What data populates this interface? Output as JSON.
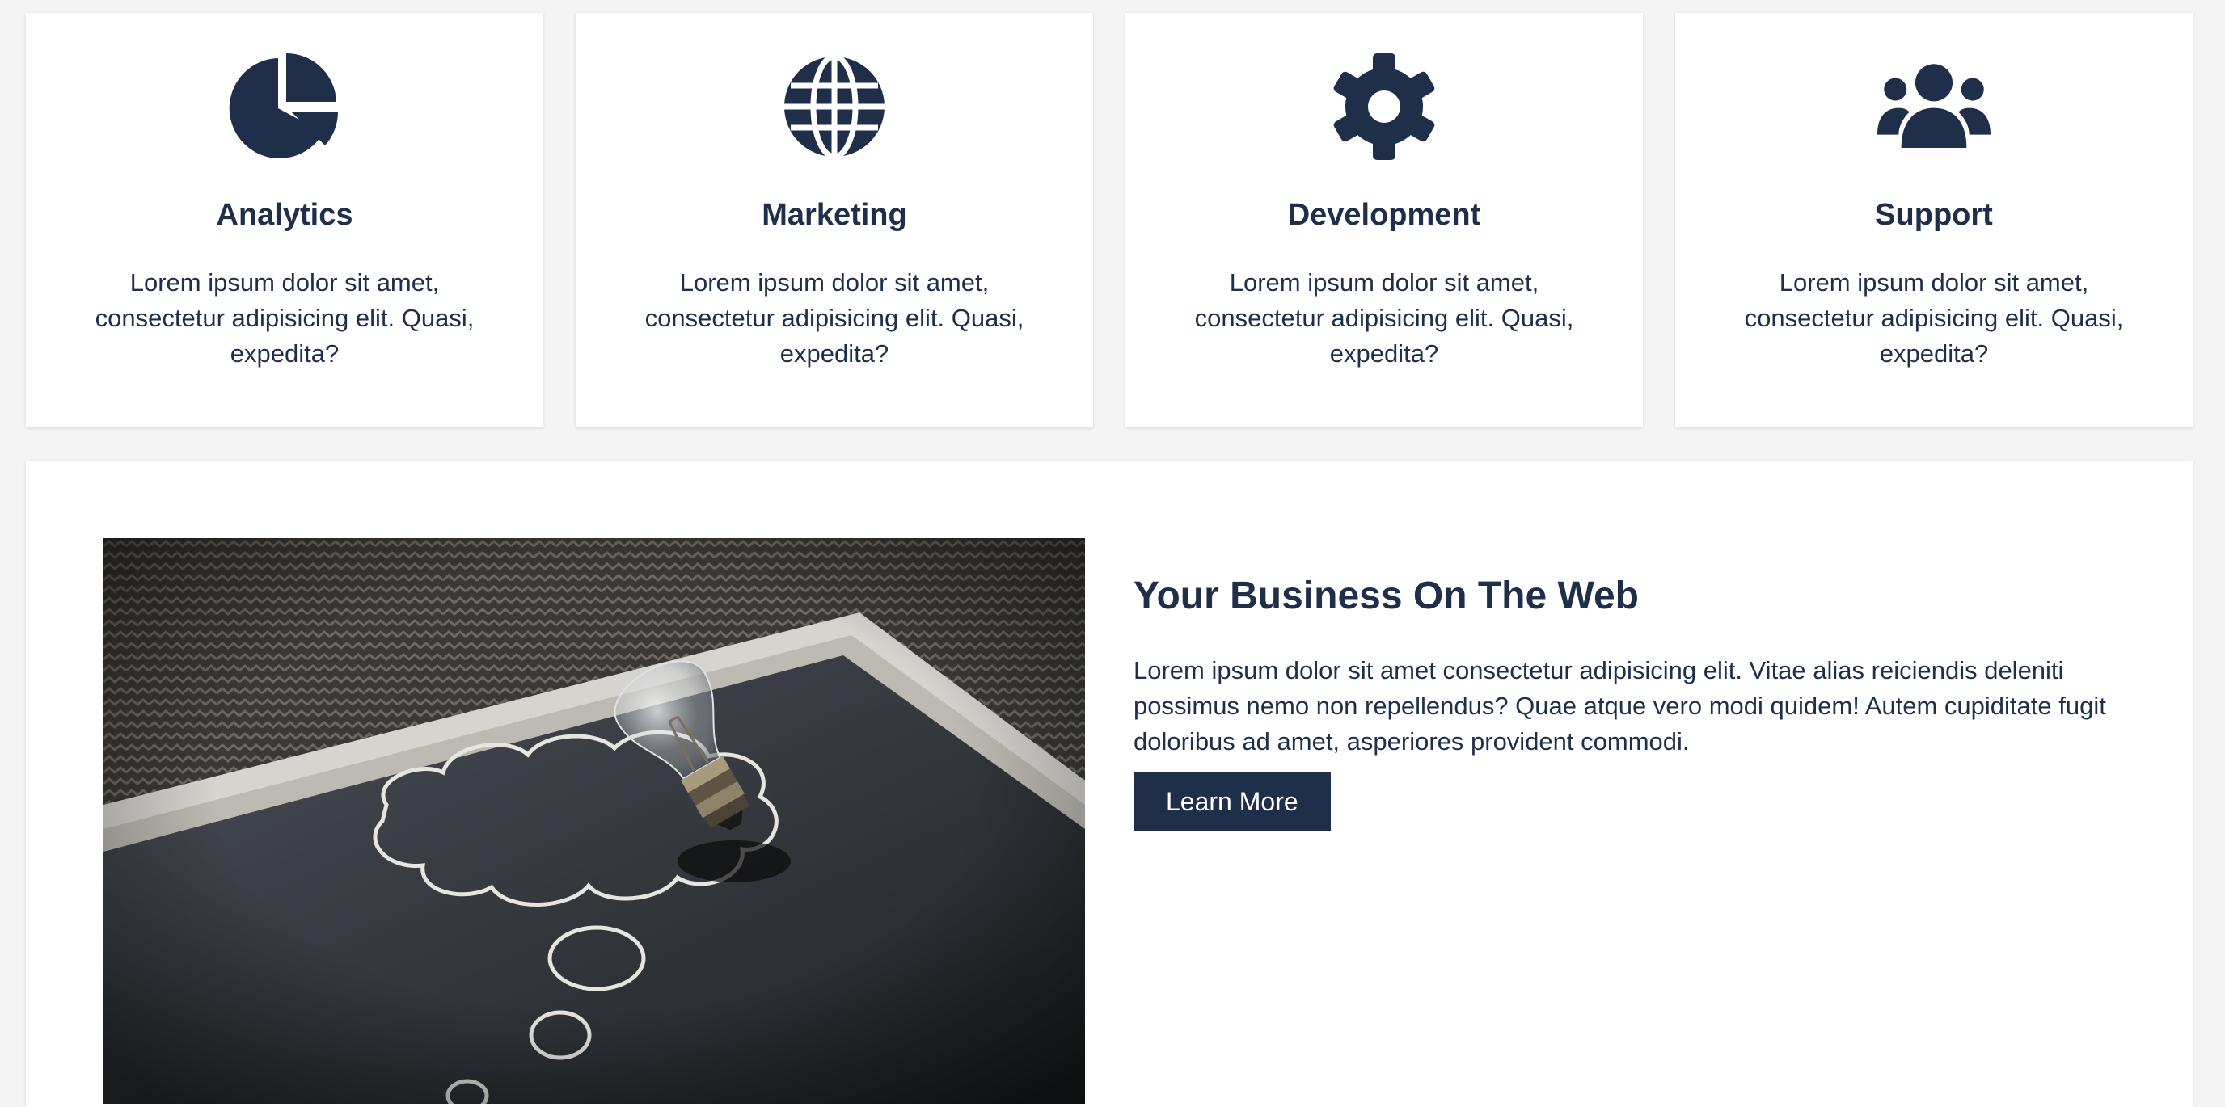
{
  "features": [
    {
      "icon": "pie-chart-icon",
      "title": "Analytics",
      "text": "Lorem ipsum dolor sit amet, consectetur adipisicing elit. Quasi, expedita?"
    },
    {
      "icon": "globe-icon",
      "title": "Marketing",
      "text": "Lorem ipsum dolor sit amet, consectetur adipisicing elit. Quasi, expedita?"
    },
    {
      "icon": "gear-icon",
      "title": "Development",
      "text": "Lorem ipsum dolor sit amet, consectetur adipisicing elit. Quasi, expedita?"
    },
    {
      "icon": "users-icon",
      "title": "Support",
      "text": "Lorem ipsum dolor sit amet, consectetur adipisicing elit. Quasi, expedita?"
    }
  ],
  "showcase": {
    "image": "lightbulb-on-chalkboard-photo",
    "title": "Your Business On The Web",
    "text": "Lorem ipsum dolor sit amet consectetur adipisicing elit. Vitae alias reiciendis deleniti possimus nemo non repellendus? Quae atque vero modi quidem! Autem cupiditate fugit doloribus ad amet, asperiores provident commodi.",
    "button_label": "Learn More"
  },
  "colors": {
    "primary": "#1f2f4a",
    "background": "#f4f4f4",
    "card": "#ffffff"
  }
}
